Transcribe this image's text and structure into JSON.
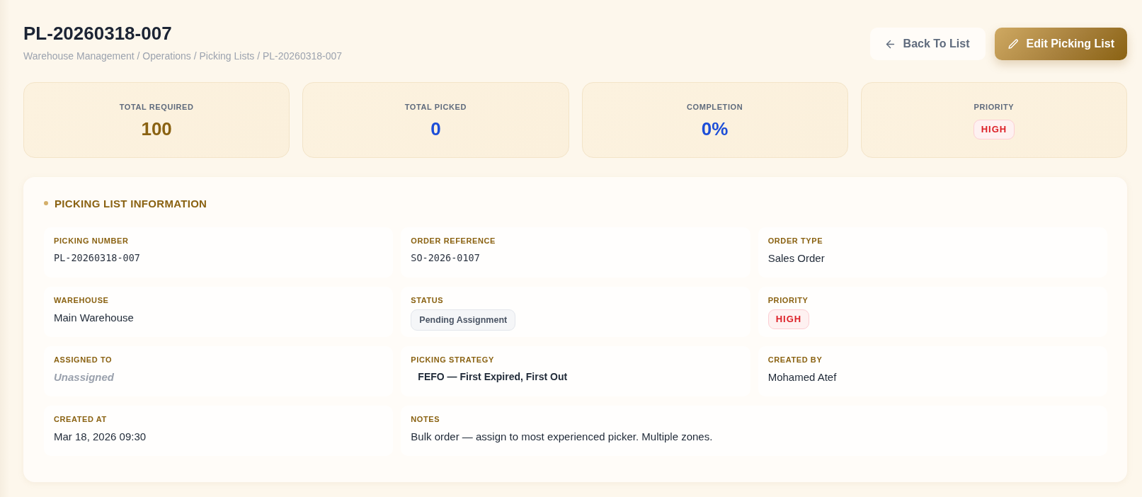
{
  "header": {
    "title": "PL-20260318-007",
    "breadcrumb": "Warehouse Management / Operations / Picking Lists / PL-20260318-007",
    "buttons": [
      {
        "label": "Back To List",
        "kind": "secondary"
      },
      {
        "label": "Edit Picking List",
        "kind": "primary"
      }
    ]
  },
  "stats": [
    {
      "label": "TOTAL REQUIRED",
      "value": "100",
      "kind": "number",
      "color": "#8a6212"
    },
    {
      "label": "TOTAL PICKED",
      "value": "0",
      "kind": "number",
      "color": "#1d4ed8"
    },
    {
      "label": "COMPLETION",
      "value": "0%",
      "kind": "number",
      "color": "#1d4ed8"
    },
    {
      "label": "PRIORITY",
      "value": "HIGH",
      "kind": "badge"
    }
  ],
  "info": {
    "title": "PICKING LIST INFORMATION",
    "fields": [
      {
        "label": "PICKING NUMBER",
        "value": "PL-20260318-007",
        "kind": "code"
      },
      {
        "label": "ORDER REFERENCE",
        "value": "SO-2026-0107",
        "kind": "code"
      },
      {
        "label": "ORDER TYPE",
        "value": "Sales Order",
        "kind": "text"
      },
      {
        "label": "WAREHOUSE",
        "value": "Main Warehouse",
        "kind": "text"
      },
      {
        "label": "STATUS",
        "value": "Pending Assignment",
        "kind": "status"
      },
      {
        "label": "PRIORITY",
        "value": "HIGH",
        "kind": "priority"
      },
      {
        "label": "ASSIGNED TO",
        "value": "Unassigned",
        "kind": "empty"
      },
      {
        "label": "PICKING STRATEGY",
        "value": "FEFO — First Expired, First Out",
        "kind": "strategy"
      },
      {
        "label": "CREATED BY",
        "value": "Mohamed Atef",
        "kind": "text"
      },
      {
        "label": "CREATED AT",
        "value": "Mar 18, 2026 09:30",
        "kind": "text"
      },
      {
        "label": "NOTES",
        "value": "Bulk order — assign to most experienced picker. Multiple zones.",
        "kind": "note"
      }
    ]
  }
}
